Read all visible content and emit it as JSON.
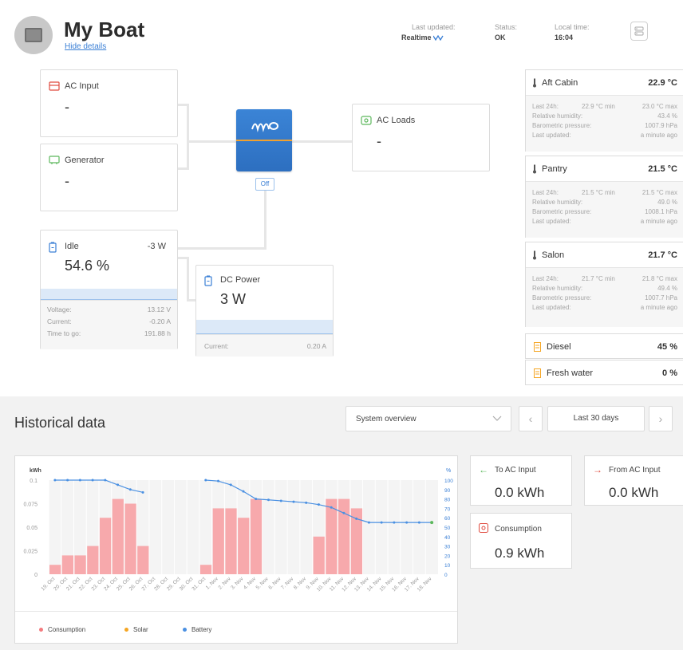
{
  "header": {
    "title": "My Boat",
    "hide_details": "Hide details",
    "last_updated_label": "Last updated:",
    "last_updated_value": "Realtime",
    "status_label": "Status:",
    "status_value": "OK",
    "local_time_label": "Local time:",
    "local_time_value": "16:04"
  },
  "ac_input": {
    "label": "AC Input",
    "value": "-"
  },
  "generator": {
    "label": "Generator",
    "value": "-"
  },
  "ac_loads": {
    "label": "AC Loads",
    "value": "-"
  },
  "inverter": {
    "state_button": "Off"
  },
  "battery": {
    "label": "Idle",
    "power": "-3 W",
    "soc": "54.6 %",
    "voltage_label": "Voltage:",
    "voltage": "13.12 V",
    "current_label": "Current:",
    "current": "-0.20 A",
    "ttg_label": "Time to go:",
    "ttg": "191.88 h"
  },
  "dc_power": {
    "label": "DC Power",
    "value": "3 W",
    "current_label": "Current:",
    "current": "0.20 A"
  },
  "sensors": [
    {
      "name": "Aft Cabin",
      "temp": "22.9 °C",
      "last24_label": "Last 24h:",
      "min": "22.9 °C min",
      "max": "23.0 °C max",
      "rh_label": "Relative humidity:",
      "rh": "43.4 %",
      "bp_label": "Barometric pressure:",
      "bp": "1007.9 hPa",
      "upd_label": "Last updated:",
      "upd": "a minute ago"
    },
    {
      "name": "Pantry",
      "temp": "21.5 °C",
      "last24_label": "Last 24h:",
      "min": "21.5 °C min",
      "max": "21.5 °C max",
      "rh_label": "Relative humidity:",
      "rh": "49.0 %",
      "bp_label": "Barometric pressure:",
      "bp": "1008.1 hPa",
      "upd_label": "Last updated:",
      "upd": "a minute ago"
    },
    {
      "name": "Salon",
      "temp": "21.7 °C",
      "last24_label": "Last 24h:",
      "min": "21.7 °C min",
      "max": "21.8 °C max",
      "rh_label": "Relative humidity:",
      "rh": "49.4 %",
      "bp_label": "Barometric pressure:",
      "bp": "1007.7 hPa",
      "upd_label": "Last updated:",
      "upd": "a minute ago"
    }
  ],
  "tanks": [
    {
      "name": "Diesel",
      "level": "45 %"
    },
    {
      "name": "Fresh water",
      "level": "0 %"
    }
  ],
  "history": {
    "title": "Historical data",
    "view_select": "System overview",
    "range": "Last 30 days",
    "prev": "‹",
    "next": "›"
  },
  "energy": {
    "to_ac_label": "To AC Input",
    "to_ac_value": "0.0 kWh",
    "from_ac_label": "From AC Input",
    "from_ac_value": "0.0 kWh",
    "consumption_label": "Consumption",
    "consumption_value": "0.9 kWh"
  },
  "colors": {
    "accent": "#3a7fd5",
    "consumption": "#f7a9ac",
    "solar": "#f5a623",
    "battery": "#4a90e2",
    "red": "#e04b3f",
    "green": "#5cb85c"
  },
  "chart_data": {
    "type": "bar",
    "title": "",
    "ylabel": "kWh",
    "y2label": "%",
    "ylim": [
      0,
      0.1
    ],
    "y2lim": [
      0,
      100
    ],
    "yticks": [
      "0.1",
      "0.075",
      "0.05",
      "0.025",
      "0"
    ],
    "y2ticks": [
      "100",
      "90",
      "80",
      "70",
      "60",
      "50",
      "40",
      "30",
      "20",
      "10",
      "0"
    ],
    "categories": [
      "19. Oct",
      "20. Oct",
      "21. Oct",
      "22. Oct",
      "23. Oct",
      "24. Oct",
      "25. Oct",
      "26. Oct",
      "27. Oct",
      "28. Oct",
      "29. Oct",
      "30. Oct",
      "31. Oct",
      "1. Nov",
      "2. Nov",
      "3. Nov",
      "4. Nov",
      "5. Nov",
      "6. Nov",
      "7. Nov",
      "8. Nov",
      "9. Nov",
      "10. Nov",
      "11. Nov",
      "12. Nov",
      "13. Nov",
      "14. Nov",
      "15. Nov",
      "16. Nov",
      "17. Nov",
      "18. Nov"
    ],
    "series": [
      {
        "name": "Consumption",
        "values": [
          0.01,
          0.02,
          0.02,
          0.03,
          0.06,
          0.08,
          0.075,
          0.03,
          0,
          0,
          0,
          0,
          0.01,
          0.07,
          0.07,
          0.06,
          0.08,
          0,
          0,
          0,
          0,
          0.04,
          0.08,
          0.08,
          0.07,
          0,
          0,
          0,
          0,
          0,
          0
        ]
      },
      {
        "name": "Solar",
        "values": [
          0,
          0,
          0,
          0,
          0,
          0,
          0,
          0,
          0,
          0,
          0,
          0,
          0,
          0,
          0,
          0,
          0,
          0,
          0,
          0,
          0,
          0,
          0,
          0,
          0,
          0,
          0,
          0,
          0,
          0,
          0
        ]
      },
      {
        "name": "Battery",
        "values": [
          100,
          100,
          100,
          100,
          100,
          95,
          90,
          87,
          null,
          null,
          null,
          null,
          100,
          99,
          95,
          88,
          80,
          79,
          78,
          77,
          76,
          74,
          71,
          65,
          59,
          55,
          55,
          55,
          55,
          55,
          55
        ]
      }
    ],
    "legend": [
      "Consumption",
      "Solar",
      "Battery"
    ],
    "legend_position": "bottom",
    "grid": true
  }
}
